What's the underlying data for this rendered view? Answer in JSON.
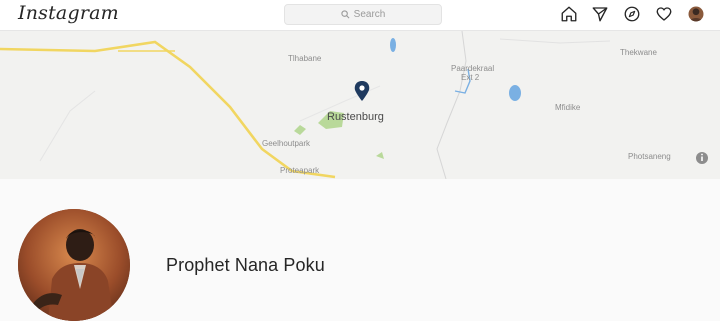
{
  "header": {
    "logo": "Instagram",
    "search_placeholder": "Search",
    "nav_icons": [
      "home-icon",
      "direct-icon",
      "explore-icon",
      "activity-icon",
      "profile-avatar"
    ]
  },
  "map": {
    "places": {
      "tlhabane": "Tlhabane",
      "thekwane": "Thekwane",
      "paardekraal": "Paardekraal",
      "paardekraal_ext": "Ext 2",
      "rustenburg": "Rustenburg",
      "mfidikoe": "Mfidike",
      "geelhoutpark": "Geelhoutpark",
      "proteapark": "Proteapark",
      "photsaneng": "Photsaneng"
    }
  },
  "profile": {
    "name": "Prophet Nana Poku"
  },
  "colors": {
    "road": "#f1d661",
    "water": "#7ab0e3",
    "park": "#b9d99a",
    "pin": "#1f3a5f",
    "text": "#262626"
  }
}
